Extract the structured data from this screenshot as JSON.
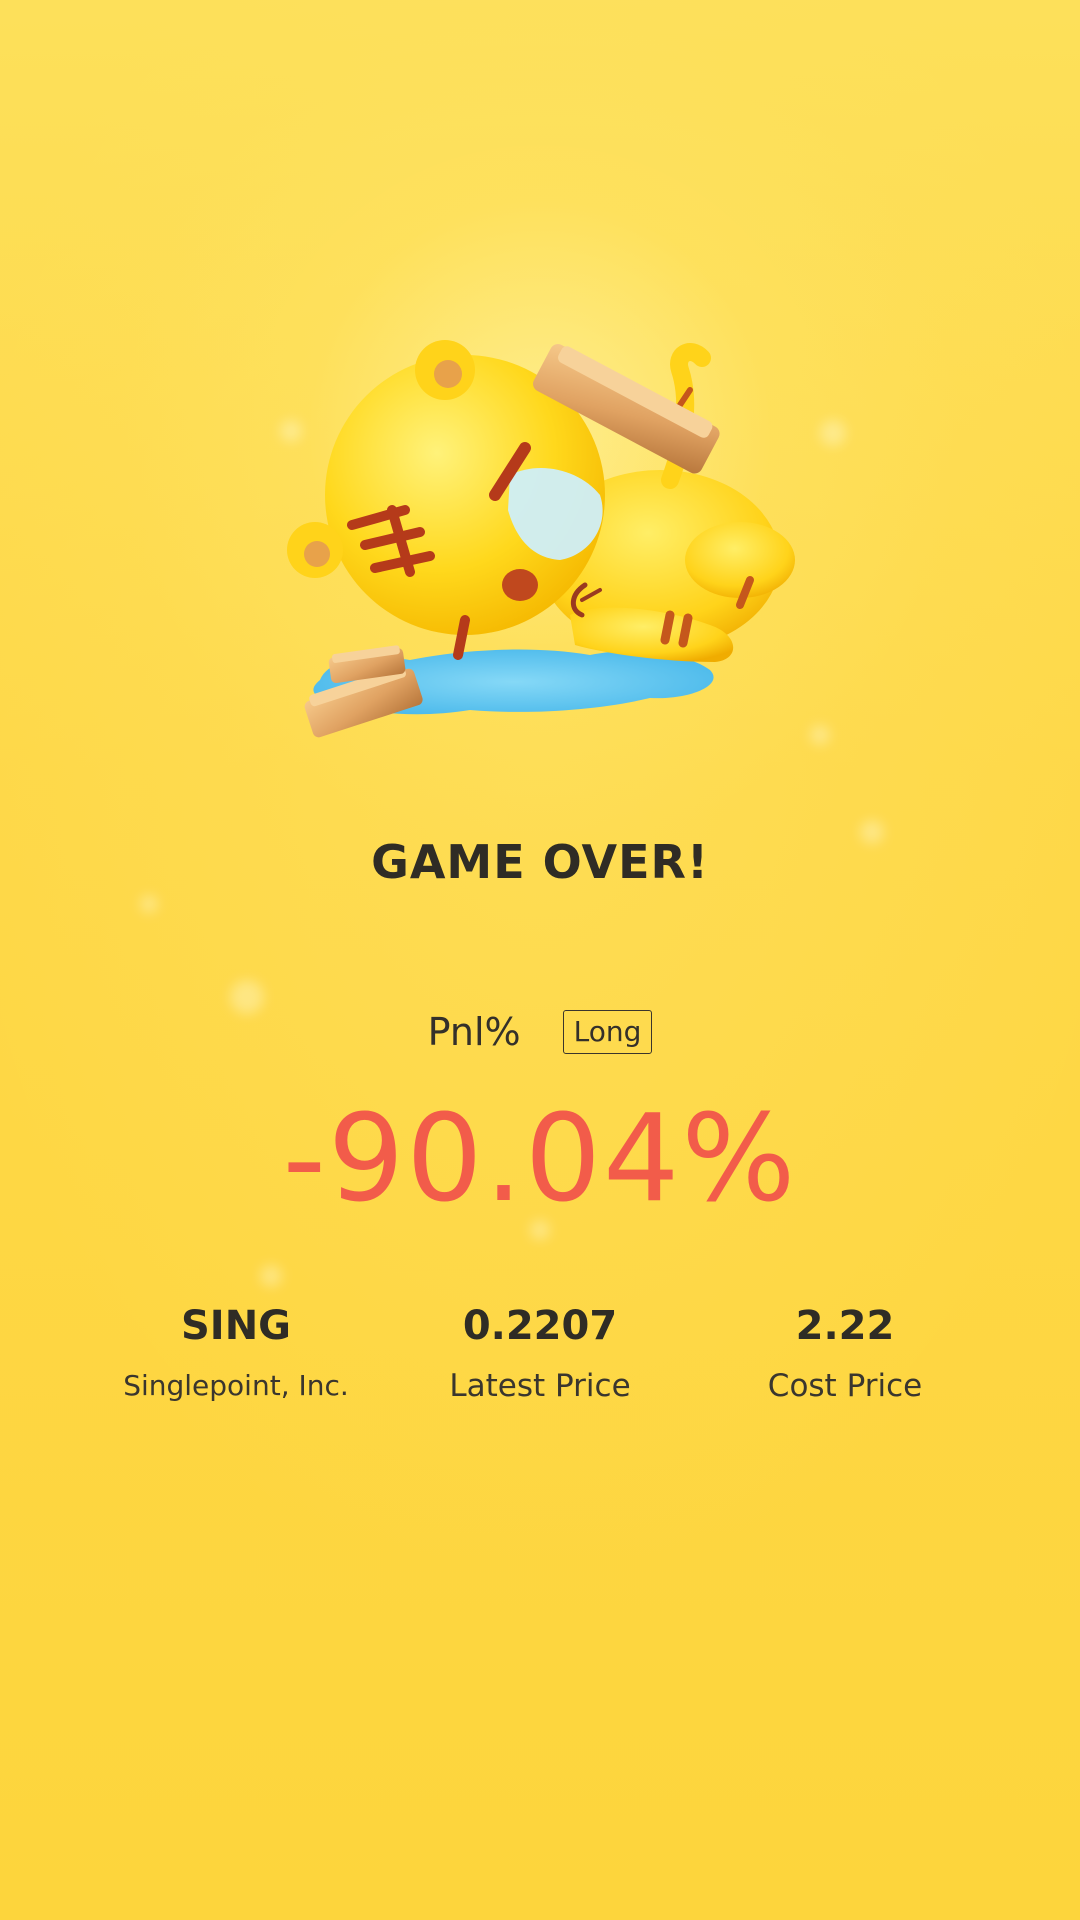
{
  "result": {
    "title": "GAME OVER!",
    "pnl_label": "Pnl%",
    "position_side": "Long",
    "pnl_value": "-90.04%",
    "pnl_color": "#f25c4a"
  },
  "stats": {
    "symbol": "SING",
    "company_name": "Singlepoint, Inc.",
    "latest_price": "0.2207",
    "latest_price_label": "Latest Price",
    "cost_price": "2.22",
    "cost_price_label": "Cost Price"
  },
  "illustration": {
    "icon": "fainted-tiger-mascot-icon",
    "background_color": "#fdd43a"
  }
}
